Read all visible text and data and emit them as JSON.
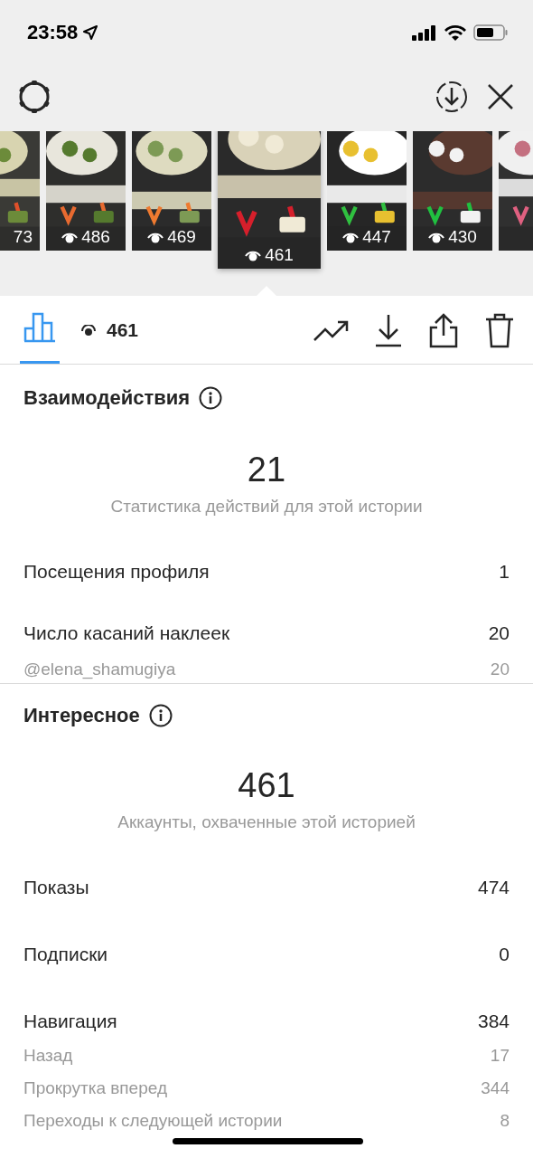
{
  "status_bar": {
    "time": "23:58"
  },
  "stories": [
    {
      "count": "73",
      "selected": false
    },
    {
      "count": "486",
      "selected": false
    },
    {
      "count": "469",
      "selected": false
    },
    {
      "count": "461",
      "selected": true
    },
    {
      "count": "447",
      "selected": false
    },
    {
      "count": "430",
      "selected": false
    },
    {
      "selected": false
    }
  ],
  "toolbar": {
    "tabs": [
      {
        "kind": "insights",
        "selected": true
      }
    ],
    "views": "461"
  },
  "sections": [
    {
      "title": "Взаимодействия",
      "total": "21",
      "caption": "Статистика действий для этой истории",
      "rows": [
        {
          "kind": "main",
          "label": "Посещения профиля",
          "value": "1"
        },
        {
          "kind": "main",
          "label": "Число касаний наклеек",
          "value": "20"
        },
        {
          "kind": "sub",
          "label": "@elena_shamugiya",
          "value": "20"
        }
      ]
    },
    {
      "title": "Интересное",
      "total": "461",
      "caption": "Аккаунты, охваченные этой историей",
      "rows": [
        {
          "kind": "main",
          "label": "Показы",
          "value": "474"
        },
        {
          "kind": "main",
          "label": "Подписки",
          "value": "0"
        },
        {
          "kind": "main",
          "label": "Навигация",
          "value": "384"
        },
        {
          "kind": "sub",
          "label": "Назад",
          "value": "17"
        },
        {
          "kind": "sub",
          "label": "Прокрутка вперед",
          "value": "344"
        },
        {
          "kind": "sub",
          "label": "Переходы к следующей истории",
          "value": "8"
        }
      ]
    }
  ]
}
